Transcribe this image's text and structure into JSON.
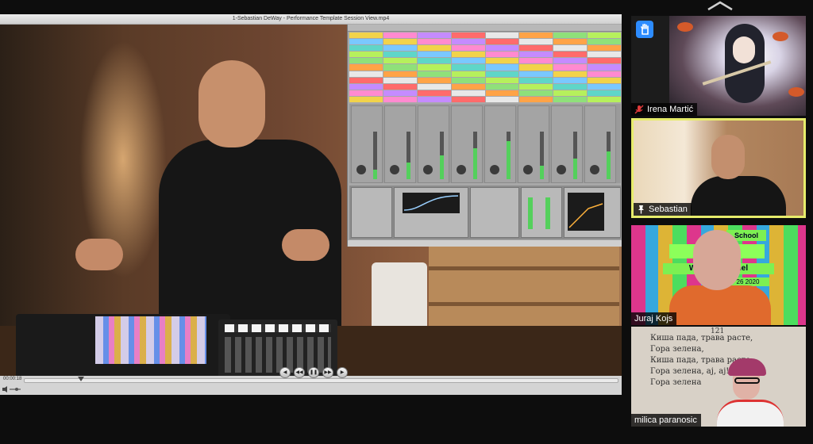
{
  "meeting": {
    "collapse_icon": "chevron-up-icon"
  },
  "player": {
    "window_title": "1-Sebastian DeWay - Performance Template Session View.mp4",
    "timecode": "00:00:18",
    "progress": 0.09,
    "controls": [
      {
        "name": "step-back",
        "glyph": "◀"
      },
      {
        "name": "rewind",
        "glyph": "◀◀"
      },
      {
        "name": "pause",
        "glyph": "❚❚"
      },
      {
        "name": "fast-forward",
        "glyph": "▶▶"
      },
      {
        "name": "step-forward",
        "glyph": "▶"
      }
    ]
  },
  "participants": [
    {
      "name": "Irena Martić",
      "muted": true,
      "raised_hand": true
    },
    {
      "name": "Sebastian",
      "pinned": true,
      "active_speaker": true
    },
    {
      "name": "Juraj Kojs",
      "banner": {
        "line1": "School",
        "line2": "FM   Uni",
        "line3": "Work   and panel",
        "line4": "26 2020"
      }
    },
    {
      "name": "milica paranosic",
      "page_number": "121",
      "verse": "Киша пада, трава расте,\nГора зелена,\nКиша пада, трава расте,\nГора зелена, ај, ај!\nГора зелена"
    }
  ],
  "colors": {
    "active_speaker_border": "#e6ec6b",
    "raise_hand_bg": "#2d8cff",
    "muted_icon": "#e03a3a"
  }
}
